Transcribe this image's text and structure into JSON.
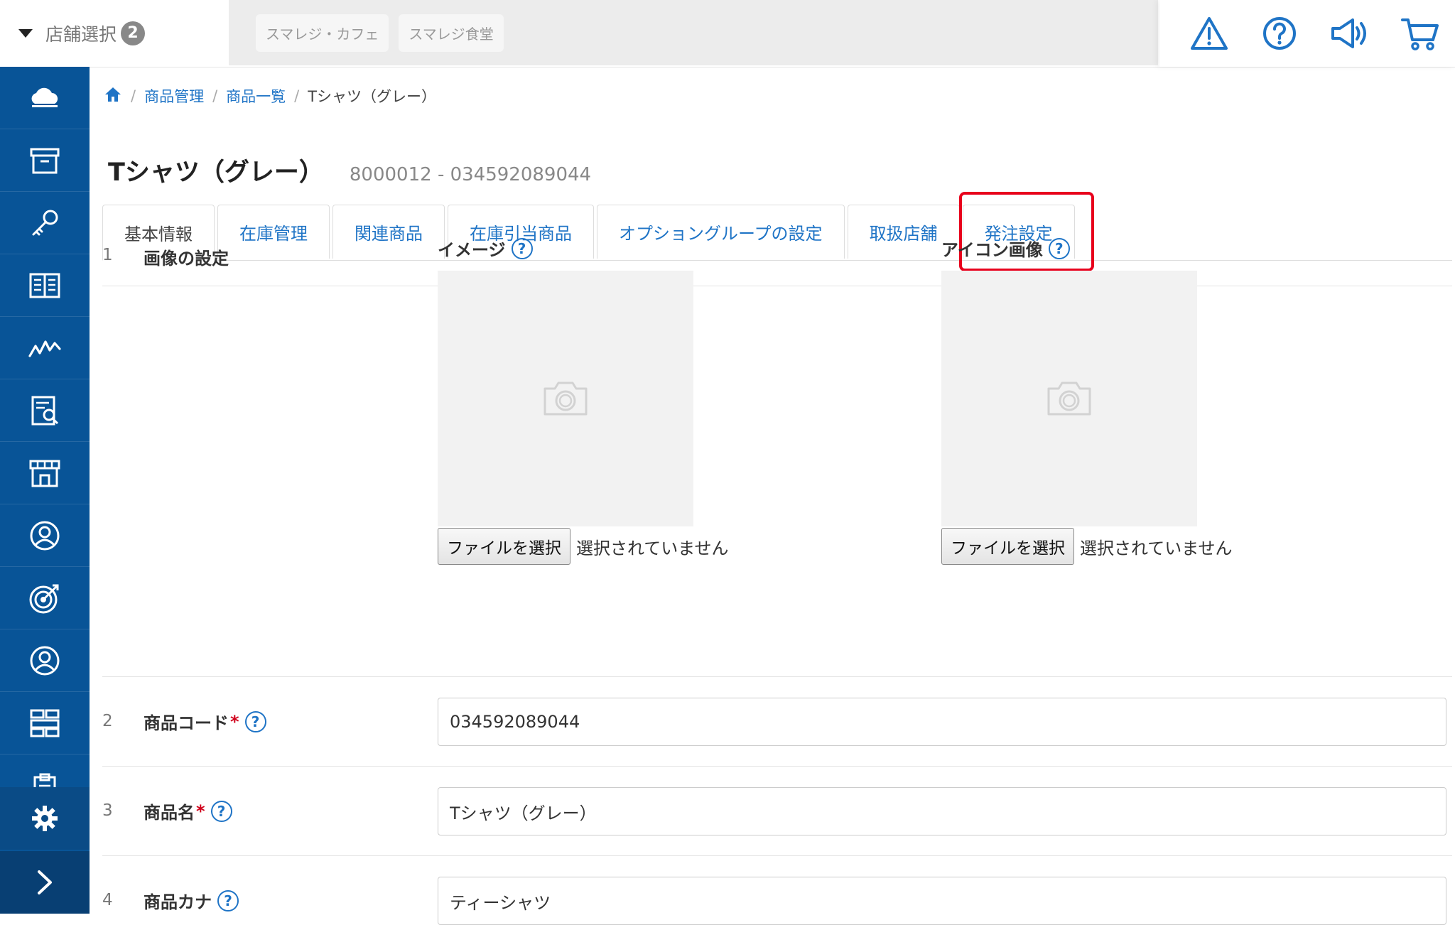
{
  "header": {
    "store_select_label": "店舗選択",
    "store_count": "2",
    "store_chips": [
      "スマレジ・カフェ",
      "スマレジ食堂"
    ]
  },
  "breadcrumb": {
    "home_icon": "home-icon",
    "items": [
      "商品管理",
      "商品一覧"
    ],
    "current": "Tシャツ（グレー）"
  },
  "product": {
    "title": "Tシャツ（グレー）",
    "code_display": "8000012 - 034592089044"
  },
  "tabs": [
    {
      "label": "基本情報",
      "active": true
    },
    {
      "label": "在庫管理"
    },
    {
      "label": "関連商品"
    },
    {
      "label": "在庫引当商品"
    },
    {
      "label": "オプショングループの設定"
    },
    {
      "label": "取扱店舗"
    },
    {
      "label": "発注設定"
    }
  ],
  "rows": [
    {
      "num": "1",
      "label": "画像の設定"
    },
    {
      "num": "2",
      "label": "商品コード",
      "value": "034592089044"
    },
    {
      "num": "3",
      "label": "商品名",
      "value": "Tシャツ（グレー）"
    },
    {
      "num": "4",
      "label": "商品カナ",
      "value": "ティーシャツ"
    }
  ],
  "images": {
    "image_label": "イメージ",
    "icon_label": "アイコン画像",
    "file_button": "ファイルを選択",
    "file_status": "選択されていません"
  },
  "help_glyph": "?",
  "required_mark": "*",
  "colors": {
    "sidebar": "#085497",
    "link": "#1f74c6",
    "highlight": "#e8001c"
  }
}
